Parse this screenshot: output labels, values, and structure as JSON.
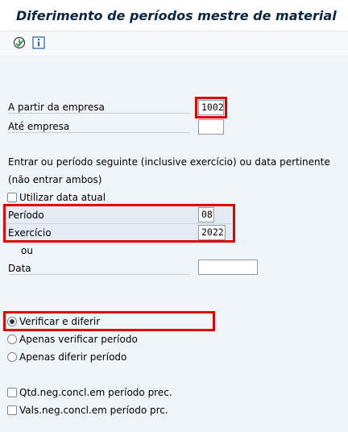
{
  "title": "Diferimento de períodos mestre de material",
  "toolbar": {
    "execute_icon": "execute-clock-icon",
    "info_icon": "info-icon"
  },
  "fields": {
    "from_company": {
      "label": "A partir da empresa",
      "value": "1002"
    },
    "to_company": {
      "label": "Até empresa",
      "value": ""
    },
    "instruction_line1": "Entrar ou período seguinte (inclusive exercício) ou data pertinente",
    "instruction_line2": "(não entrar ambos)",
    "use_current_date": "Utilizar data atual",
    "period": {
      "label": "Período",
      "value": "08"
    },
    "fiscal_year": {
      "label": "Exercício",
      "value": "2022"
    },
    "or_label": "ou",
    "date": {
      "label": "Data",
      "value": ""
    }
  },
  "options": {
    "check_and_defer": "Verificar e diferir",
    "check_only": "Apenas verificar período",
    "defer_only": "Apenas diferir período",
    "selected": "check_and_defer"
  },
  "checkboxes": {
    "neg_qty": "Qtd.neg.concl.em período prec.",
    "neg_val": "Vals.neg.concl.em período prc."
  },
  "colors": {
    "highlight": "#e00000",
    "title": "#0a2640",
    "background": "#eff4f9"
  }
}
